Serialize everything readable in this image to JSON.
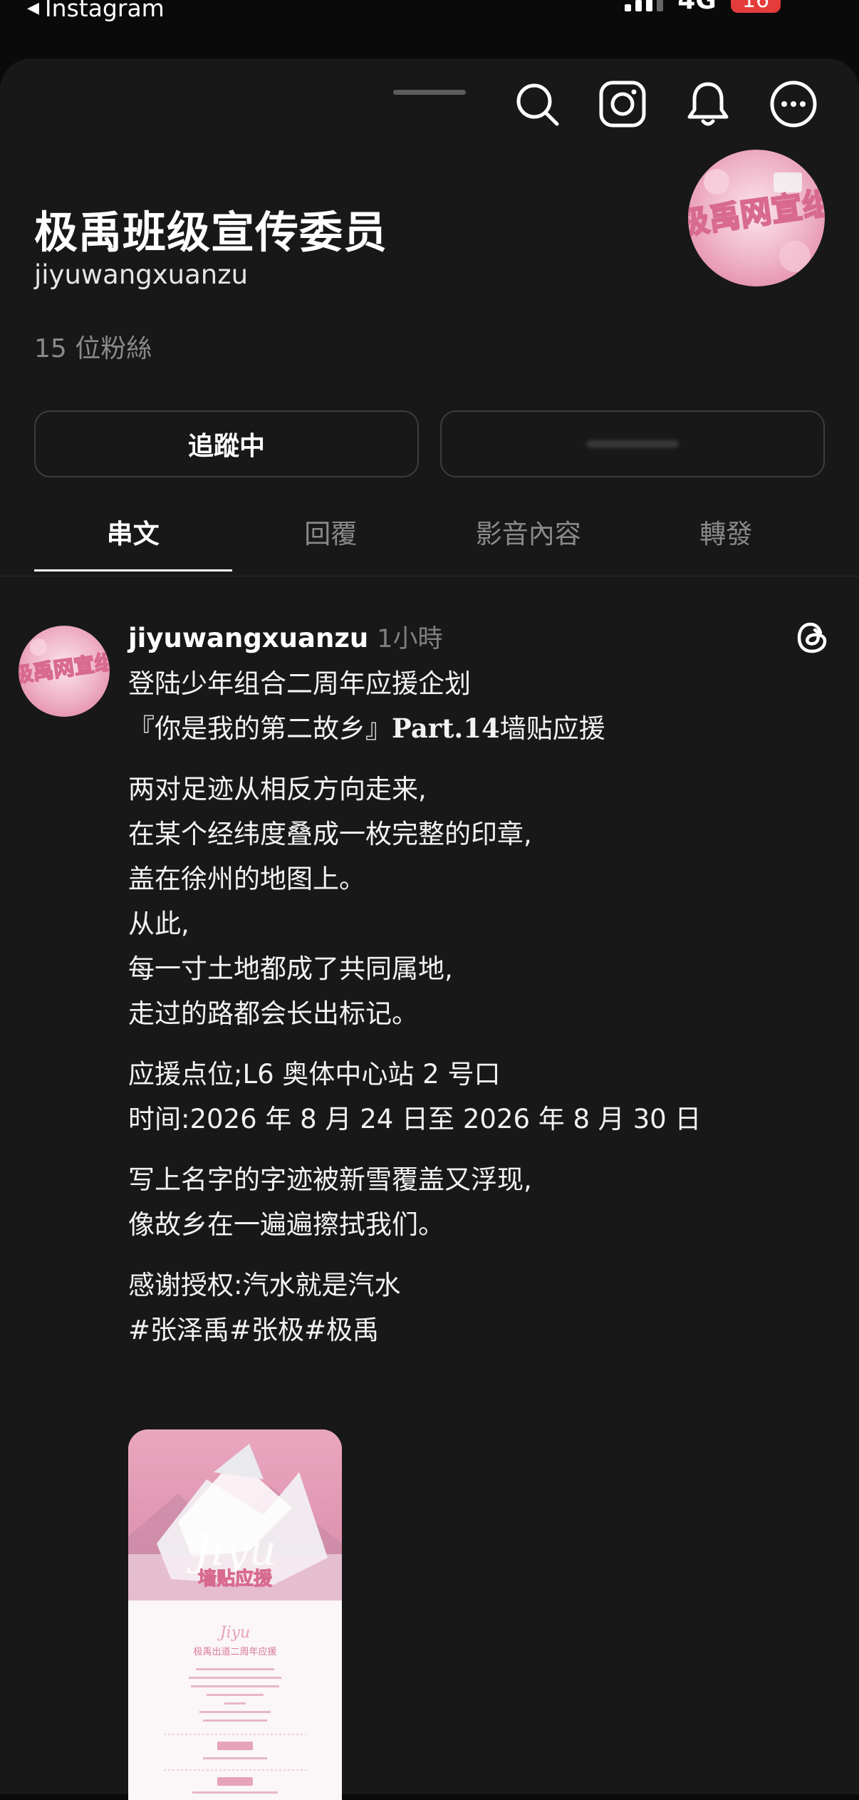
{
  "status_bar": {
    "back_app": "Instagram",
    "network": "4G",
    "battery": "16"
  },
  "profile": {
    "name": "极禹班级宣传委员",
    "handle": "jiyuwangxuanzu",
    "followers": "15 位粉絲",
    "avatar_text": "极禹网宣组"
  },
  "buttons": {
    "follow_label": "追蹤中"
  },
  "tabs": [
    {
      "label": "串文",
      "active": true
    },
    {
      "label": "回覆",
      "active": false
    },
    {
      "label": "影音內容",
      "active": false
    },
    {
      "label": "轉發",
      "active": false
    }
  ],
  "post": {
    "username": "jiyuwangxuanzu",
    "time": "1小時",
    "title_line1": "登陆少年组合二周年应援企划",
    "title_line2_a": "『你是我的第二故乡』",
    "title_line2_b": "Part.14",
    "title_line2_c": "墙贴应援",
    "poem": [
      "两对足迹从相反方向走来,",
      "在某个经纬度叠成一枚完整的印章,",
      "盖在徐州的地图上。",
      "从此,",
      "每一寸土地都成了共同属地,",
      "走过的路都会长出标记。"
    ],
    "location": "应援点位;L6 奥体中心站 2 号口",
    "time_range": "时间:2026 年 8 月 24 日至 2026 年 8 月 30 日",
    "closing": [
      "写上名字的字迹被新雪覆盖又浮现,",
      "像故乡在一遍遍擦拭我们。"
    ],
    "credit": "感谢授权:汽水就是汽水",
    "hashtags": "#张泽禹#张极#极禹",
    "media": {
      "heading": "墙贴应援",
      "script": "Jiyu",
      "subtitle": "极禹出道二周年应援"
    }
  },
  "colors": {
    "background": "#181818",
    "accent_pink": "#e9a7be",
    "battery_red": "#e43b3b"
  }
}
